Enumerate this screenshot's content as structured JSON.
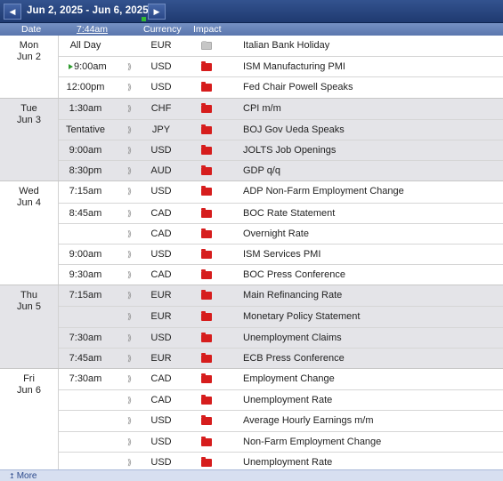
{
  "toolbar": {
    "range_label": "Jun 2, 2025 - Jun 6, 2025",
    "prev_icon": "◀",
    "next_icon": "▶"
  },
  "columns": {
    "date": "Date",
    "time": "7:44am",
    "currency": "Currency",
    "impact": "Impact"
  },
  "days": [
    {
      "weekday": "Mon",
      "date": "Jun 2",
      "events": [
        {
          "time": "All Day",
          "currency": "EUR",
          "impact": "holiday",
          "title": "Italian Bank Holiday",
          "detail": false
        },
        {
          "time": "9:00am",
          "currency": "USD",
          "impact": "high",
          "title": "ISM Manufacturing PMI",
          "detail": true,
          "next": true
        },
        {
          "time": "12:00pm",
          "currency": "USD",
          "impact": "high",
          "title": "Fed Chair Powell Speaks",
          "detail": true
        }
      ]
    },
    {
      "weekday": "Tue",
      "date": "Jun 3",
      "events": [
        {
          "time": "1:30am",
          "currency": "CHF",
          "impact": "high",
          "title": "CPI m/m",
          "detail": true
        },
        {
          "time": "Tentative",
          "currency": "JPY",
          "impact": "high",
          "title": "BOJ Gov Ueda Speaks",
          "detail": true
        },
        {
          "time": "9:00am",
          "currency": "USD",
          "impact": "high",
          "title": "JOLTS Job Openings",
          "detail": true
        },
        {
          "time": "8:30pm",
          "currency": "AUD",
          "impact": "high",
          "title": "GDP q/q",
          "detail": true
        }
      ]
    },
    {
      "weekday": "Wed",
      "date": "Jun 4",
      "events": [
        {
          "time": "7:15am",
          "currency": "USD",
          "impact": "high",
          "title": "ADP Non-Farm Employment Change",
          "detail": true
        },
        {
          "time": "8:45am",
          "currency": "CAD",
          "impact": "high",
          "title": "BOC Rate Statement",
          "detail": true
        },
        {
          "time": "",
          "currency": "CAD",
          "impact": "high",
          "title": "Overnight Rate",
          "detail": true
        },
        {
          "time": "9:00am",
          "currency": "USD",
          "impact": "high",
          "title": "ISM Services PMI",
          "detail": true
        },
        {
          "time": "9:30am",
          "currency": "CAD",
          "impact": "high",
          "title": "BOC Press Conference",
          "detail": true
        }
      ]
    },
    {
      "weekday": "Thu",
      "date": "Jun 5",
      "events": [
        {
          "time": "7:15am",
          "currency": "EUR",
          "impact": "high",
          "title": "Main Refinancing Rate",
          "detail": true
        },
        {
          "time": "",
          "currency": "EUR",
          "impact": "high",
          "title": "Monetary Policy Statement",
          "detail": true
        },
        {
          "time": "7:30am",
          "currency": "USD",
          "impact": "high",
          "title": "Unemployment Claims",
          "detail": true
        },
        {
          "time": "7:45am",
          "currency": "EUR",
          "impact": "high",
          "title": "ECB Press Conference",
          "detail": true
        }
      ]
    },
    {
      "weekday": "Fri",
      "date": "Jun 6",
      "events": [
        {
          "time": "7:30am",
          "currency": "CAD",
          "impact": "high",
          "title": "Employment Change",
          "detail": true
        },
        {
          "time": "",
          "currency": "CAD",
          "impact": "high",
          "title": "Unemployment Rate",
          "detail": true
        },
        {
          "time": "",
          "currency": "USD",
          "impact": "high",
          "title": "Average Hourly Earnings m/m",
          "detail": true
        },
        {
          "time": "",
          "currency": "USD",
          "impact": "high",
          "title": "Non-Farm Employment Change",
          "detail": true
        },
        {
          "time": "",
          "currency": "USD",
          "impact": "high",
          "title": "Unemployment Rate",
          "detail": true
        }
      ]
    }
  ],
  "detail_glyph": "⟫",
  "footer": {
    "more_label": "More",
    "more_icon": "↥"
  },
  "colors": {
    "header_blue": "#2a4787",
    "high_impact": "#d61d1d",
    "holiday_impact": "#c6c6c6",
    "next_marker": "#2e9b2e",
    "alt_row": "#e4e4e8"
  }
}
